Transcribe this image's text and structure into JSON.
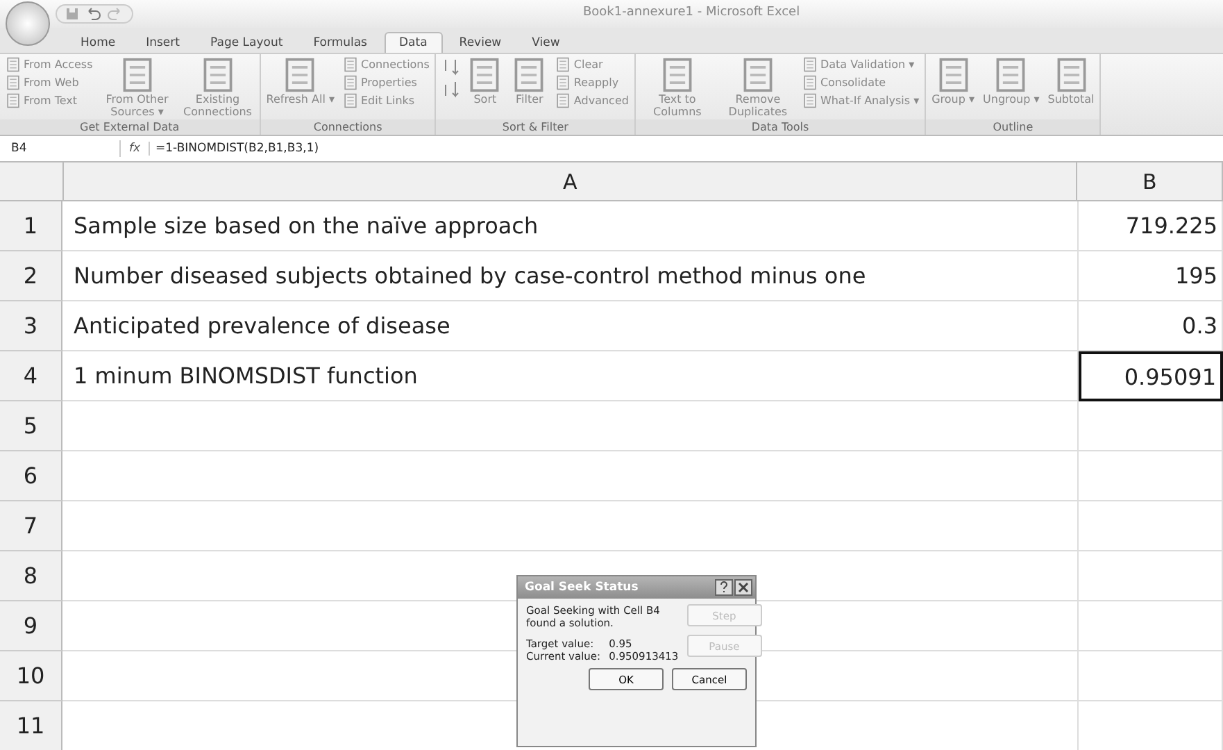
{
  "window": {
    "title": "Book1-annexure1 - Microsoft Excel"
  },
  "tabs": [
    {
      "label": "Home",
      "selected": false
    },
    {
      "label": "Insert",
      "selected": false
    },
    {
      "label": "Page Layout",
      "selected": false
    },
    {
      "label": "Formulas",
      "selected": false
    },
    {
      "label": "Data",
      "selected": true
    },
    {
      "label": "Review",
      "selected": false
    },
    {
      "label": "View",
      "selected": false
    }
  ],
  "ribbon_groups": [
    {
      "label": "Get External Data",
      "items": [
        {
          "kind": "stack",
          "labels": [
            "From Access",
            "From Web",
            "From Text"
          ]
        },
        {
          "kind": "large",
          "label": "From Other Sources ▾"
        },
        {
          "kind": "large",
          "label": "Existing Connections"
        }
      ]
    },
    {
      "label": "Connections",
      "items": [
        {
          "kind": "large",
          "label": "Refresh All ▾"
        },
        {
          "kind": "stack",
          "labels": [
            "Connections",
            "Properties",
            "Edit Links"
          ]
        }
      ]
    },
    {
      "label": "Sort & Filter",
      "items": [
        {
          "kind": "sort",
          "label": "Sort"
        },
        {
          "kind": "large",
          "label": "Filter"
        },
        {
          "kind": "stack",
          "labels": [
            "Clear",
            "Reapply",
            "Advanced"
          ]
        }
      ]
    },
    {
      "label": "Data Tools",
      "items": [
        {
          "kind": "large",
          "label": "Text to Columns"
        },
        {
          "kind": "large",
          "label": "Remove Duplicates"
        },
        {
          "kind": "stack",
          "labels": [
            "Data Validation ▾",
            "Consolidate",
            "What-If Analysis ▾"
          ]
        }
      ]
    },
    {
      "label": "Outline",
      "items": [
        {
          "kind": "large",
          "label": "Group ▾"
        },
        {
          "kind": "large",
          "label": "Ungroup ▾"
        },
        {
          "kind": "large",
          "label": "Subtotal"
        }
      ]
    }
  ],
  "formula_bar": {
    "name_box": "B4",
    "fx": "fx",
    "formula": "=1-BINOMDIST(B2,B1,B3,1)"
  },
  "sheet": {
    "columns": [
      "A",
      "B"
    ],
    "rows": [
      {
        "number": "1",
        "a": "Sample size based on the naïve approach",
        "b": "719.225",
        "selected": false
      },
      {
        "number": "2",
        "a": "Number diseased subjects obtained by case-control method minus one",
        "b": "195",
        "selected": false
      },
      {
        "number": "3",
        "a": "Anticipated prevalence  of disease",
        "b": "0.3",
        "selected": false
      },
      {
        "number": "4",
        "a": "1 minum BINOMSDIST function",
        "b": "0.95091",
        "selected": true
      },
      {
        "number": "5",
        "a": "",
        "b": "",
        "selected": false
      },
      {
        "number": "6",
        "a": "",
        "b": "",
        "selected": false
      },
      {
        "number": "7",
        "a": "",
        "b": "",
        "selected": false
      },
      {
        "number": "8",
        "a": "",
        "b": "",
        "selected": false
      },
      {
        "number": "9",
        "a": "",
        "b": "",
        "selected": false
      },
      {
        "number": "10",
        "a": "",
        "b": "",
        "selected": false
      },
      {
        "number": "11",
        "a": "",
        "b": "",
        "selected": false
      }
    ]
  },
  "dialog": {
    "title": "Goal Seek Status",
    "message": "Goal Seeking with Cell B4 found a solution.",
    "target_label": "Target value:",
    "target_value": "0.95",
    "current_label": "Current value:",
    "current_value": "0.950913413",
    "buttons": [
      {
        "label": "Step",
        "disabled": true
      },
      {
        "label": "Pause",
        "disabled": true
      },
      {
        "label": "OK",
        "disabled": false
      },
      {
        "label": "Cancel",
        "disabled": false
      }
    ]
  }
}
